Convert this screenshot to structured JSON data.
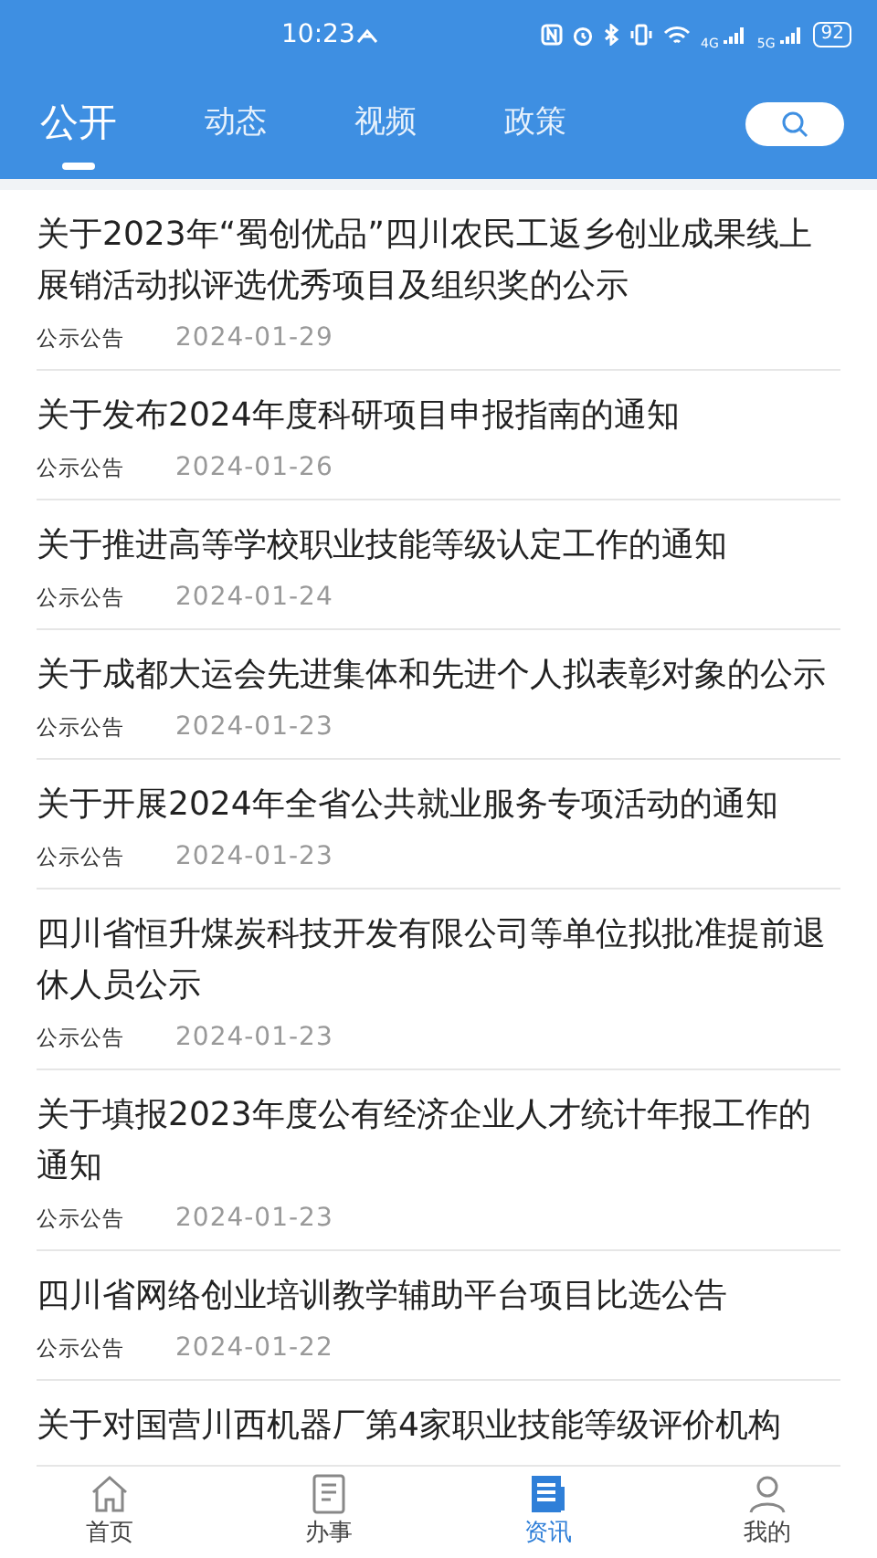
{
  "status_bar": {
    "time": "10:23",
    "network_labels": [
      "4G",
      "5G"
    ],
    "battery": "92"
  },
  "tabs": [
    {
      "label": "公开",
      "selected": true
    },
    {
      "label": "动态",
      "selected": false
    },
    {
      "label": "视频",
      "selected": false
    },
    {
      "label": "政策",
      "selected": false
    }
  ],
  "articles": [
    {
      "title": "关于2023年“蜀创优品”四川农民工返乡创业成果线上展销活动拟评选优秀项目及组织奖的公示",
      "category": "公示公告",
      "date": "2024-01-29"
    },
    {
      "title": "关于发布2024年度科研项目申报指南的通知",
      "category": "公示公告",
      "date": "2024-01-26"
    },
    {
      "title": "关于推进高等学校职业技能等级认定工作的通知",
      "category": "公示公告",
      "date": "2024-01-24"
    },
    {
      "title": "关于成都大运会先进集体和先进个人拟表彰对象的公示",
      "category": "公示公告",
      "date": "2024-01-23"
    },
    {
      "title": "关于开展2024年全省公共就业服务专项活动的通知",
      "category": "公示公告",
      "date": "2024-01-23"
    },
    {
      "title": "四川省恒升煤炭科技开发有限公司等单位拟批准提前退休人员公示",
      "category": "公示公告",
      "date": "2024-01-23"
    },
    {
      "title": "关于填报2023年度公有经济企业人才统计年报工作的通知",
      "category": "公示公告",
      "date": "2024-01-23"
    },
    {
      "title": "四川省网络创业培训教学辅助平台项目比选公告",
      "category": "公示公告",
      "date": "2024-01-22"
    },
    {
      "title": "关于对国营川西机器厂第4家职业技能等级评价机构"
    }
  ],
  "bottom_nav": [
    {
      "label": "首页",
      "kind": "home",
      "selected": false
    },
    {
      "label": "办事",
      "kind": "task",
      "selected": false
    },
    {
      "label": "资讯",
      "kind": "news",
      "selected": true
    },
    {
      "label": "我的",
      "kind": "user",
      "selected": false
    }
  ]
}
